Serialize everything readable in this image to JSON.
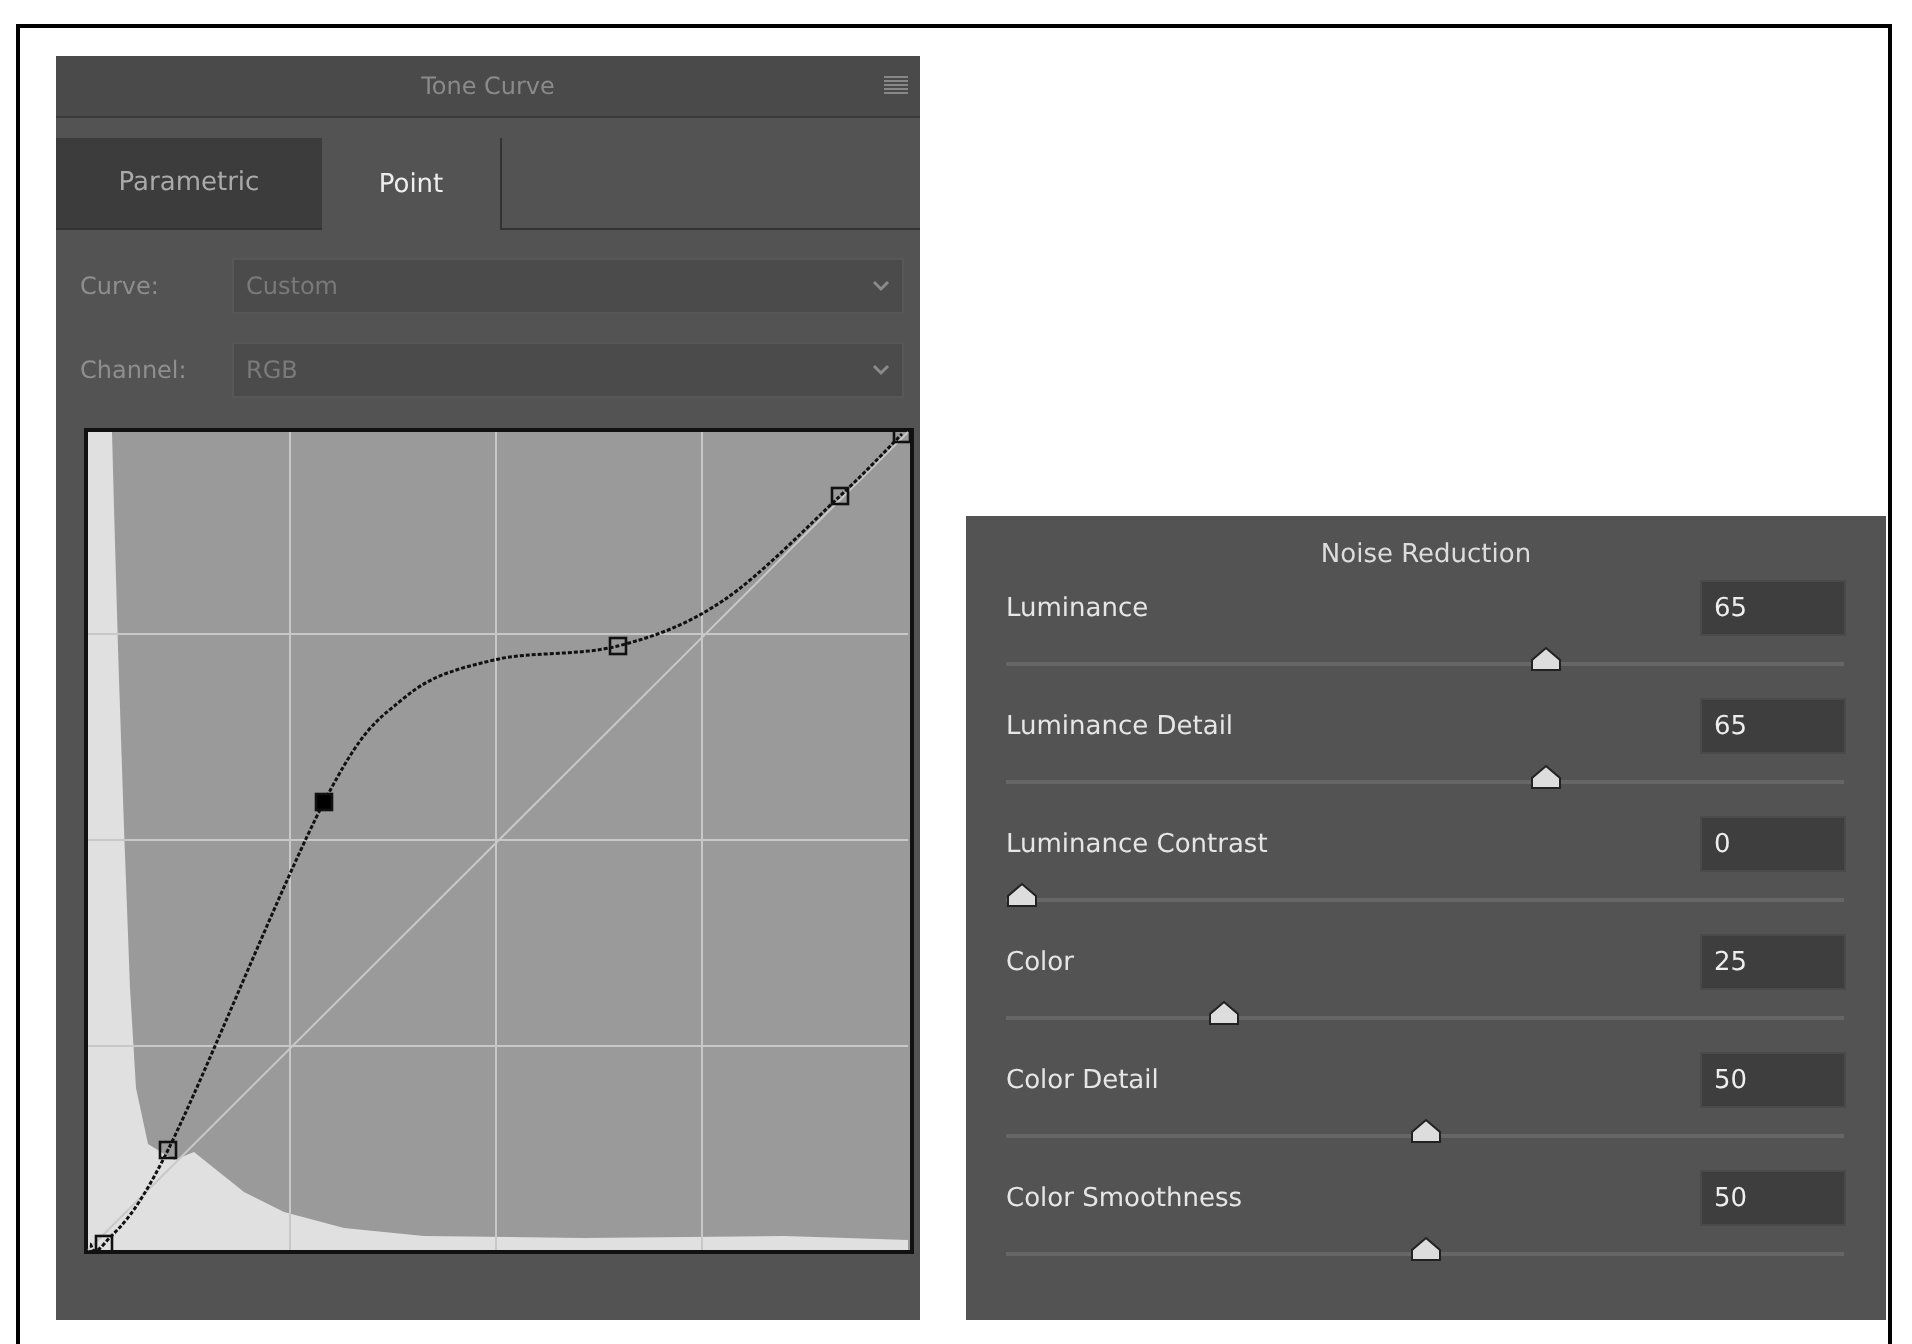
{
  "tone_curve": {
    "title": "Tone Curve",
    "tabs": [
      {
        "label": "Parametric",
        "selected": false
      },
      {
        "label": "Point",
        "selected": true
      }
    ],
    "dropdowns": [
      {
        "label": "Curve:",
        "value": "Custom"
      },
      {
        "label": "Channel:",
        "value": "RGB"
      }
    ]
  },
  "noise_reduction": {
    "title": "Noise Reduction",
    "sliders": [
      {
        "name": "Luminance",
        "value": "65",
        "level": 0.65
      },
      {
        "name": "Luminance Detail",
        "value": "65",
        "level": 0.65
      },
      {
        "name": "Luminance Contrast",
        "value": "0",
        "level": 0
      },
      {
        "name": "Color",
        "value": "25",
        "level": 0.25
      },
      {
        "name": "Color Detail",
        "value": "50",
        "level": 0.5
      },
      {
        "name": "Color Smoothness",
        "value": "50",
        "level": 0.5
      }
    ]
  }
}
